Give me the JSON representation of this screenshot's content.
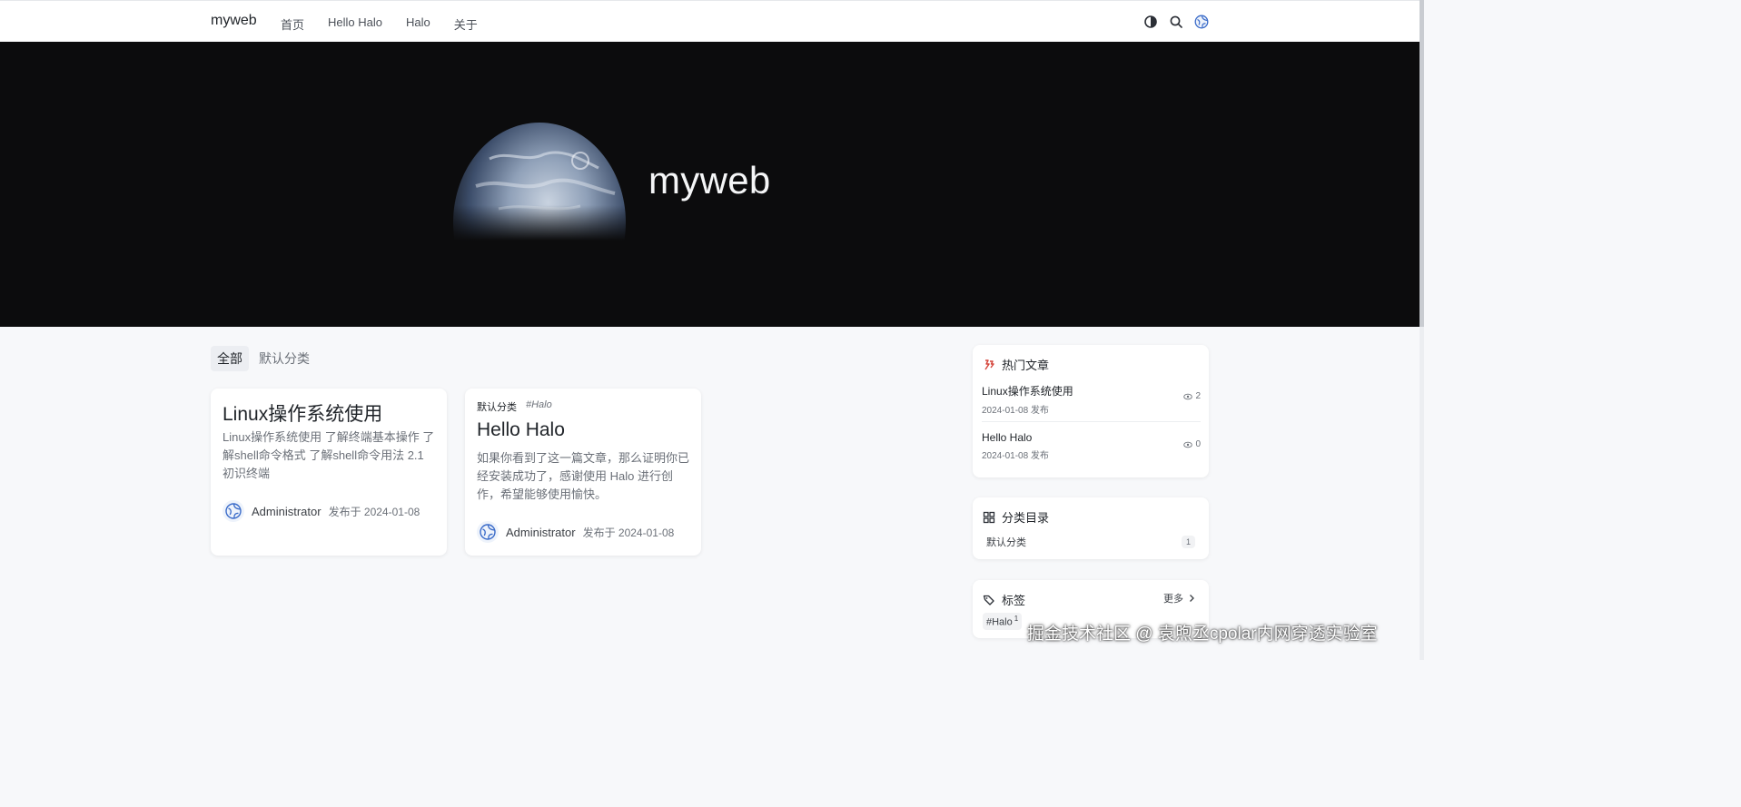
{
  "header": {
    "brand": "myweb",
    "nav": [
      "首页",
      "Hello Halo",
      "Halo",
      "关于"
    ],
    "icons": [
      "theme-toggle-icon",
      "search-icon",
      "avatar-icon"
    ]
  },
  "hero": {
    "title": "myweb"
  },
  "tabs": [
    {
      "label": "全部",
      "active": true
    },
    {
      "label": "默认分类",
      "active": false
    }
  ],
  "posts": [
    {
      "title": "Linux操作系统使用",
      "excerpt": "Linux操作系统使用 了解终端基本操作 了解shell命令格式 了解shell命令用法 2.1 初识终端",
      "author": "Administrator",
      "published": "发布于 2024-01-08"
    },
    {
      "category": "默认分类",
      "tag": "#Halo",
      "title": "Hello Halo",
      "excerpt": "如果你看到了这一篇文章，那么证明你已经安装成功了，感谢使用 Halo 进行创作，希望能够使用愉快。",
      "author": "Administrator",
      "published": "发布于 2024-01-08"
    }
  ],
  "sidebar": {
    "popular": {
      "title": "热门文章",
      "items": [
        {
          "title": "Linux操作系统使用",
          "date": "2024-01-08 发布",
          "views": "2"
        },
        {
          "title": "Hello Halo",
          "date": "2024-01-08 发布",
          "views": "0"
        }
      ]
    },
    "categories": {
      "title": "分类目录",
      "items": [
        {
          "name": "默认分类",
          "count": "1"
        }
      ]
    },
    "tags": {
      "title": "标签",
      "more": "更多",
      "items": [
        {
          "name": "#Halo",
          "count": "1"
        }
      ]
    }
  },
  "watermark": "掘金技术社区 @ 袁煦丞cpolar内网穿透实验室",
  "colors": {
    "hero_bg": "#0c0c0d",
    "page_bg": "#f7f8fa",
    "accent_blue": "#3a6bc9",
    "hot_red": "#d4443a"
  }
}
